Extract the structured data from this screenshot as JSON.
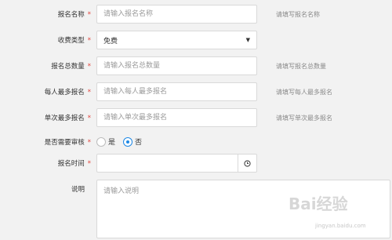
{
  "form": {
    "name": {
      "label": "报名名称",
      "required_mark": "*",
      "placeholder": "请输入报名名称",
      "hint": "请填写报名名称"
    },
    "fee_type": {
      "label": "收费类型",
      "required_mark": "*",
      "value": "免费",
      "caret": "▼"
    },
    "total": {
      "label": "报名总数量",
      "required_mark": "*",
      "placeholder": "请输入报名总数量",
      "hint": "请填写报名总数量"
    },
    "per_person": {
      "label": "每人最多报名",
      "required_mark": "*",
      "placeholder": "请输入每人最多报名",
      "hint": "请填写每人最多报名"
    },
    "per_time": {
      "label": "单次最多报名",
      "required_mark": "*",
      "placeholder": "请输入单次最多报名",
      "hint": "请填写单次最多报名"
    },
    "review": {
      "label": "是否需要审核",
      "required_mark": "*",
      "options": [
        {
          "label": "是",
          "checked": false
        },
        {
          "label": "否",
          "checked": true
        }
      ]
    },
    "time": {
      "label": "报名时间",
      "required_mark": "*",
      "value": "",
      "icon": "clock-icon"
    },
    "description": {
      "label": "说明",
      "placeholder": "请输入说明"
    }
  },
  "watermark": {
    "logo": "Bai经验",
    "sub": "jingyan.baidu.com"
  },
  "colors": {
    "required": "#e2443c",
    "accent": "#1e88e5",
    "background": "#f2f2f2"
  }
}
